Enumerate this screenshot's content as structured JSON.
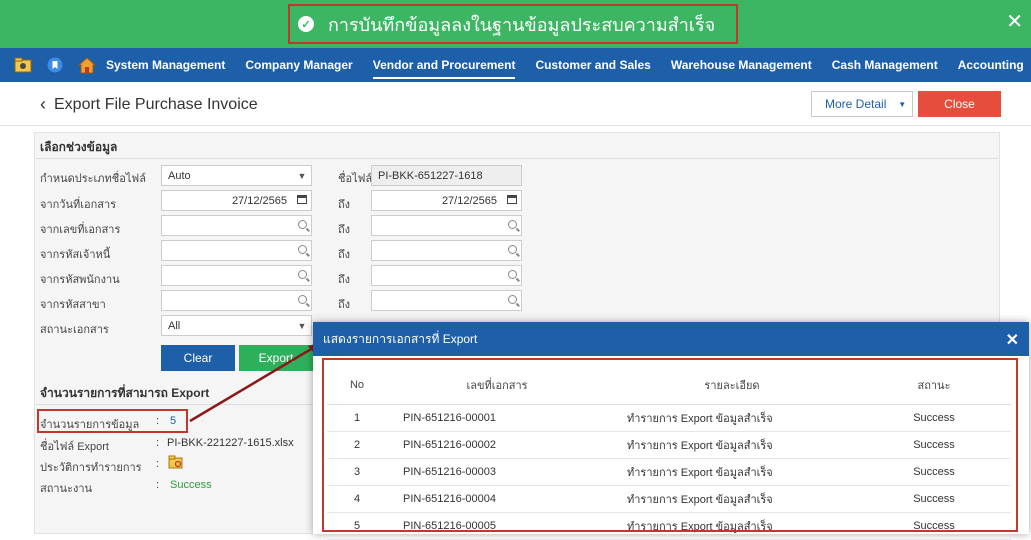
{
  "banner": {
    "message": "การบันทึกข้อมูลลงในฐานข้อมูลประสบความสำเร็จ",
    "close_icon": "✕"
  },
  "nav": {
    "icons": [
      "folder-icon",
      "bookmark-icon",
      "home-icon"
    ],
    "items": [
      {
        "label": "System Management",
        "active": false
      },
      {
        "label": "Company Manager",
        "active": false
      },
      {
        "label": "Vendor and Procurement",
        "active": true
      },
      {
        "label": "Customer and Sales",
        "active": false
      },
      {
        "label": "Warehouse Management",
        "active": false
      },
      {
        "label": "Cash Management",
        "active": false
      },
      {
        "label": "Accounting",
        "active": false
      }
    ]
  },
  "header": {
    "back": "‹",
    "title": "Export File Purchase Invoice",
    "more_detail": "More Detail",
    "close": "Close"
  },
  "filter": {
    "section_title": "เลือกช่วงข้อมูล",
    "file_type_label": "กำหนดประเภทชื่อไฟล์",
    "file_type_value": "Auto",
    "file_name_label": "ชื่อไฟล์",
    "file_name_value": "PI-BKK-651227-1618",
    "from_date_label": "จากวันที่เอกสาร",
    "from_date_value": "27/12/2565",
    "to_label": "ถึง",
    "to_date_value": "27/12/2565",
    "from_doc_label": "จากเลขที่เอกสาร",
    "from_creditor_label": "จากรหัสเจ้าหนี้",
    "from_employee_label": "จากรหัสพนักงาน",
    "from_branch_label": "จากรหัสสาขา",
    "doc_status_label": "สถานะเอกสาร",
    "doc_status_value": "All",
    "clear_button": "Clear",
    "export_button": "Export"
  },
  "summary": {
    "section_title": "จำนวนรายการที่สามารถ Export",
    "count_label": "จำนวนรายการข้อมูล",
    "count_value": "5",
    "export_file_label": "ชื่อไฟล์ Export",
    "export_file_value": "PI-BKK-221227-1615.xlsx",
    "history_label": "ประวัติการทำรายการ",
    "status_label": "สถานะงาน",
    "status_value": "Success",
    "colon": ":"
  },
  "modal": {
    "title": "แสดงรายการเอกสารที่ Export",
    "close": "✕",
    "columns": [
      "No",
      "เลขที่เอกสาร",
      "รายละเอียด",
      "สถานะ"
    ],
    "rows": [
      {
        "no": "1",
        "doc": "PIN-651216-00001",
        "detail": "ทำรายการ Export ข้อมูลสำเร็จ",
        "status": "Success"
      },
      {
        "no": "2",
        "doc": "PIN-651216-00002",
        "detail": "ทำรายการ Export ข้อมูลสำเร็จ",
        "status": "Success"
      },
      {
        "no": "3",
        "doc": "PIN-651216-00003",
        "detail": "ทำรายการ Export ข้อมูลสำเร็จ",
        "status": "Success"
      },
      {
        "no": "4",
        "doc": "PIN-651216-00004",
        "detail": "ทำรายการ Export ข้อมูลสำเร็จ",
        "status": "Success"
      },
      {
        "no": "5",
        "doc": "PIN-651216-00005",
        "detail": "ทำรายการ Export ข้อมูลสำเร็จ",
        "status": "Success"
      }
    ]
  },
  "colors": {
    "banner": "#3cb663",
    "nav": "#1d5fa8",
    "close_button": "#e74c3c",
    "export_button": "#2eaf5b",
    "success_text": "#2e9e3e",
    "highlight_box": "#c0392b"
  }
}
